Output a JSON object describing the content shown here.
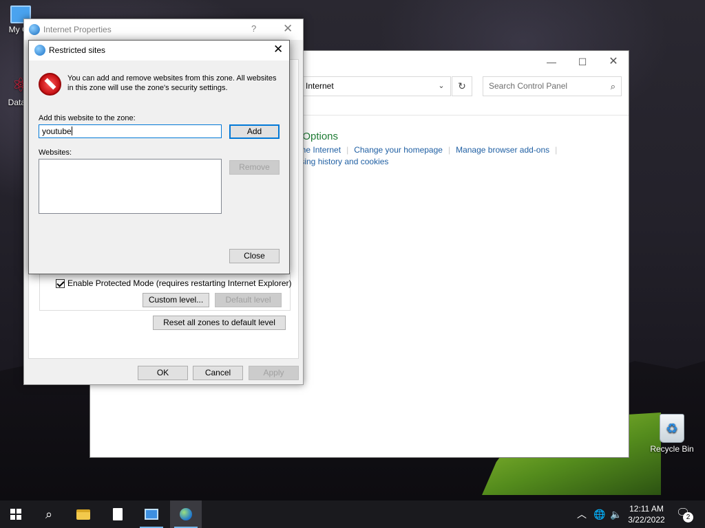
{
  "desktop": {
    "icons": [
      {
        "label": "My Co"
      },
      {
        "label": "DataW"
      },
      {
        "label": "Recycle Bin"
      }
    ]
  },
  "control_panel": {
    "address": "Internet",
    "search_placeholder": "Search Control Panel",
    "heading": "t Options",
    "links_row1": [
      "to the Internet",
      "Change your homepage",
      "Manage browser add-ons"
    ],
    "links_row2": [
      "owsing history and cookies"
    ]
  },
  "internet_properties": {
    "title": "Internet Properties",
    "help": "?",
    "protected_mode_label": "Enable Protected Mode (requires restarting Internet Explorer)",
    "protected_mode_checked": true,
    "custom_level_label": "Custom level...",
    "default_level_label": "Default level",
    "reset_zones_label": "Reset all zones to default level",
    "ok_label": "OK",
    "cancel_label": "Cancel",
    "apply_label": "Apply"
  },
  "restricted_sites": {
    "title": "Restricted sites",
    "description": "You can add and remove websites from this zone. All websites in this zone will use the zone's security settings.",
    "add_label": "Add this website to the zone:",
    "input_value": "youtube",
    "add_button": "Add",
    "websites_label": "Websites:",
    "websites": [],
    "remove_button": "Remove",
    "close_button": "Close"
  },
  "taskbar": {
    "time": "12:11 AM",
    "date": "3/22/2022",
    "notification_count": "2"
  }
}
